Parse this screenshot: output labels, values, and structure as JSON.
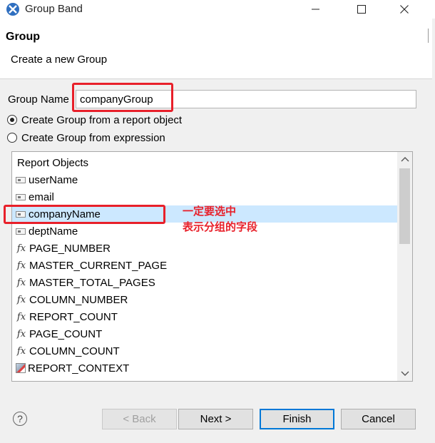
{
  "window": {
    "title": "Group Band"
  },
  "header": {
    "title": "Group",
    "description": "Create a new Group"
  },
  "form": {
    "name_label": "Group Name",
    "name_value": "companyGroup",
    "radio_report_object": "Create Group from a report object",
    "radio_expression": "Create Group from expression",
    "selected_radio": "report_object"
  },
  "list": {
    "items": [
      {
        "label": "Report Objects",
        "icon": "none"
      },
      {
        "label": "userName",
        "icon": "field-icon"
      },
      {
        "label": "email",
        "icon": "field-icon"
      },
      {
        "label": "companyName",
        "icon": "field-icon",
        "selected": true
      },
      {
        "label": "deptName",
        "icon": "field-icon"
      },
      {
        "label": "PAGE_NUMBER",
        "icon": "fx-icon"
      },
      {
        "label": "MASTER_CURRENT_PAGE",
        "icon": "fx-icon"
      },
      {
        "label": "MASTER_TOTAL_PAGES",
        "icon": "fx-icon"
      },
      {
        "label": "COLUMN_NUMBER",
        "icon": "fx-icon"
      },
      {
        "label": "REPORT_COUNT",
        "icon": "fx-icon"
      },
      {
        "label": "PAGE_COUNT",
        "icon": "fx-icon"
      },
      {
        "label": "COLUMN_COUNT",
        "icon": "fx-icon"
      },
      {
        "label": "REPORT_CONTEXT",
        "icon": "context-icon"
      }
    ]
  },
  "annotation": {
    "line1": "一定要选中",
    "line2": "表示分组的字段",
    "color": "#e8202a"
  },
  "buttons": {
    "back": "< Back",
    "next": "Next >",
    "finish": "Finish",
    "cancel": "Cancel"
  },
  "colors": {
    "selection": "#cce8ff",
    "default_button_border": "#0078d7"
  }
}
